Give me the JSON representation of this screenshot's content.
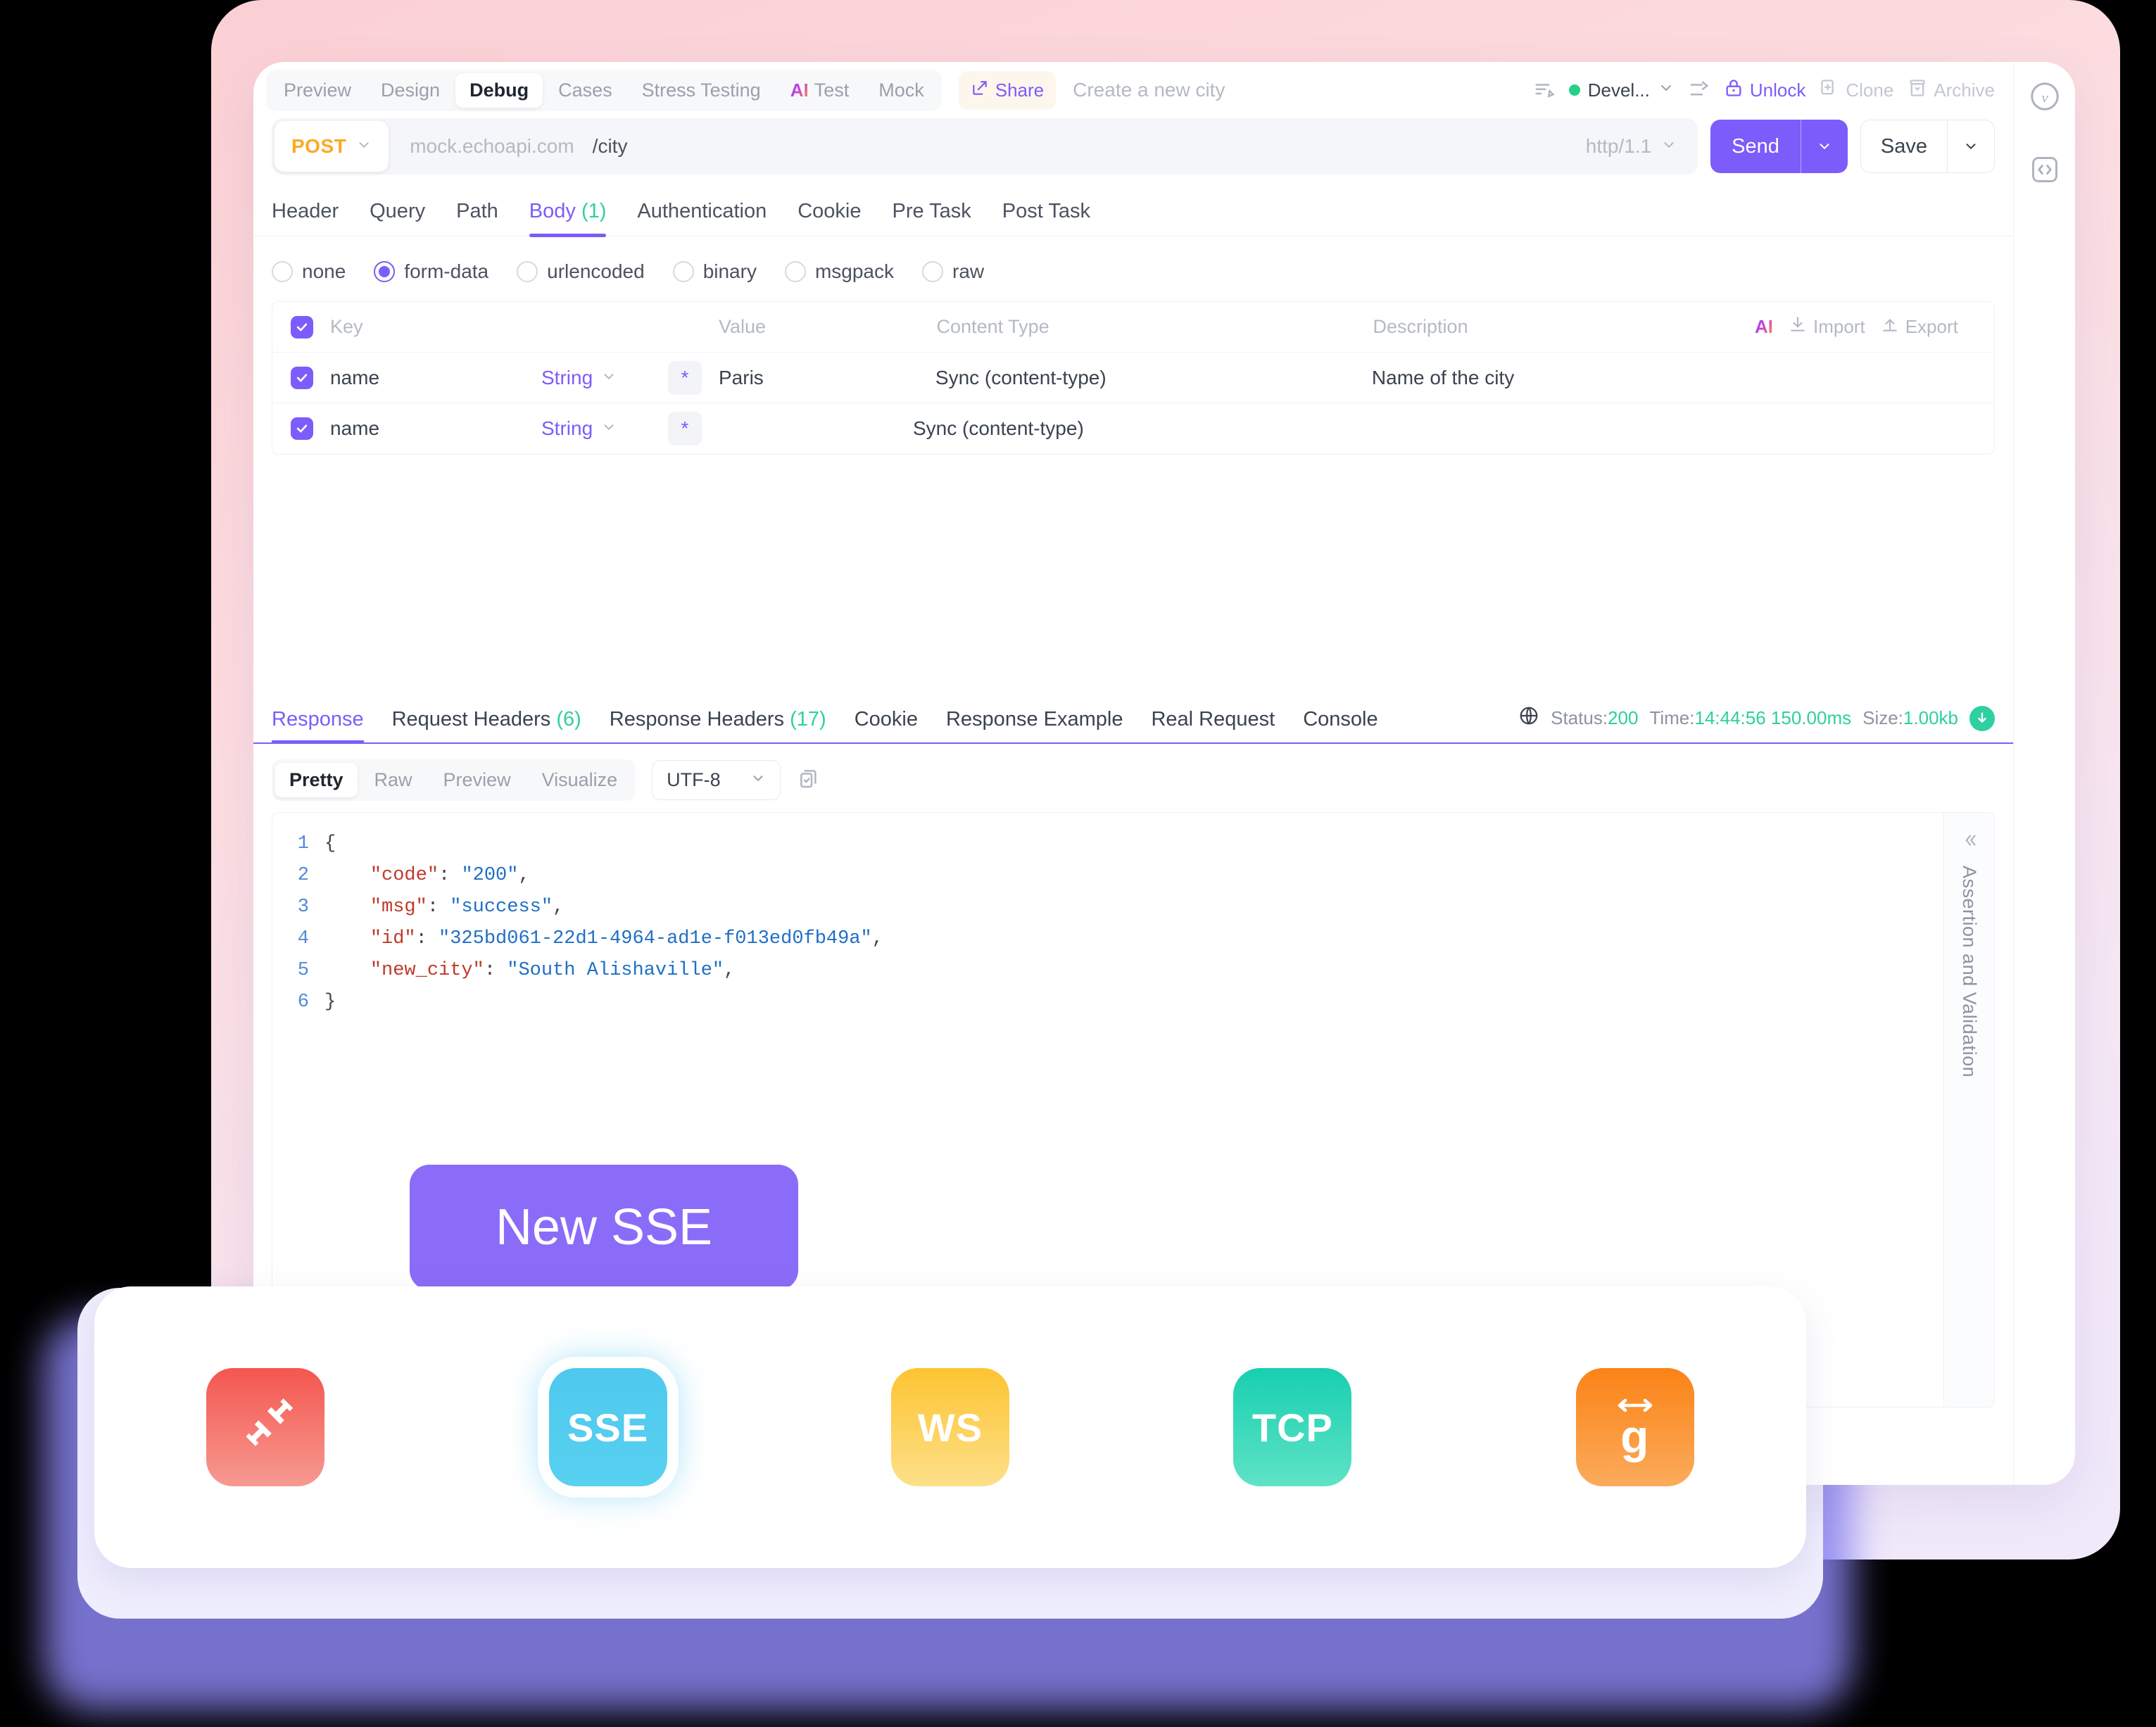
{
  "mode_tabs": [
    {
      "label": "Preview",
      "active": false,
      "ai": false
    },
    {
      "label": "Design",
      "active": false,
      "ai": false
    },
    {
      "label": "Debug",
      "active": true,
      "ai": false
    },
    {
      "label": "Cases",
      "active": false,
      "ai": false
    },
    {
      "label": "Stress Testing",
      "active": false,
      "ai": false
    },
    {
      "label": "Test",
      "active": false,
      "ai": true,
      "ai_mark": "AI"
    },
    {
      "label": "Mock",
      "active": false,
      "ai": false
    }
  ],
  "topbar": {
    "share_label": "Share",
    "request_title": "Create a new city",
    "environment": "Devel...",
    "unlock_label": "Unlock",
    "clone_label": "Clone",
    "archive_label": "Archive",
    "avatar_letter": "V"
  },
  "url_bar": {
    "method": "POST",
    "host": "mock.echoapi.com",
    "path": "/city",
    "http_version": "http/1.1",
    "send_label": "Send",
    "save_label": "Save"
  },
  "request_tabs": [
    {
      "label": "Header",
      "count": "",
      "active": false
    },
    {
      "label": "Query",
      "count": "",
      "active": false
    },
    {
      "label": "Path",
      "count": "",
      "active": false
    },
    {
      "label": "Body",
      "count": "(1)",
      "active": true
    },
    {
      "label": "Authentication",
      "count": "",
      "active": false
    },
    {
      "label": "Cookie",
      "count": "",
      "active": false
    },
    {
      "label": "Pre Task",
      "count": "",
      "active": false
    },
    {
      "label": "Post Task",
      "count": "",
      "active": false
    }
  ],
  "body_types": [
    {
      "label": "none",
      "selected": false
    },
    {
      "label": "form-data",
      "selected": true
    },
    {
      "label": "urlencoded",
      "selected": false
    },
    {
      "label": "binary",
      "selected": false
    },
    {
      "label": "msgpack",
      "selected": false
    },
    {
      "label": "raw",
      "selected": false
    }
  ],
  "params_table": {
    "headers": {
      "key": "Key",
      "value": "Value",
      "content_type": "Content Type",
      "description": "Description"
    },
    "tools": {
      "ai": "AI",
      "import": "Import",
      "export": "Export"
    },
    "rows": [
      {
        "checked": true,
        "key": "name",
        "type": "String",
        "required": "*",
        "value": "Paris",
        "content_type": "Sync (content-type)",
        "description": "Name of the city"
      },
      {
        "checked": true,
        "key": "name",
        "type": "String",
        "required": "*",
        "value": "",
        "content_type": "Sync (content-type)",
        "description": ""
      }
    ]
  },
  "response_tabs": [
    {
      "label": "Response",
      "count": "",
      "active": true
    },
    {
      "label": "Request Headers",
      "count": "(6)",
      "active": false
    },
    {
      "label": "Response Headers",
      "count": "(17)",
      "active": false
    },
    {
      "label": "Cookie",
      "count": "",
      "active": false
    },
    {
      "label": "Response Example",
      "count": "",
      "active": false
    },
    {
      "label": "Real Request",
      "count": "",
      "active": false
    },
    {
      "label": "Console",
      "count": "",
      "active": false
    }
  ],
  "response_meta": {
    "status_label": "Status:",
    "status_value": "200",
    "time_label": "Time:",
    "time_value": "14:44:56 150.00ms",
    "size_label": "Size:",
    "size_value": "1.00kb"
  },
  "format_bar": {
    "segments": [
      {
        "label": "Pretty",
        "active": true
      },
      {
        "label": "Raw",
        "active": false
      },
      {
        "label": "Preview",
        "active": false
      },
      {
        "label": "Visualize",
        "active": false
      }
    ],
    "encoding": "UTF-8"
  },
  "response_body": {
    "lines": [
      {
        "n": "1",
        "parts": [
          {
            "t": "{",
            "c": "p"
          }
        ]
      },
      {
        "n": "2",
        "parts": [
          {
            "t": "    ",
            "c": "p"
          },
          {
            "t": "\"code\"",
            "c": "k"
          },
          {
            "t": ": ",
            "c": "p"
          },
          {
            "t": "\"200\"",
            "c": "s"
          },
          {
            "t": ",",
            "c": "p"
          }
        ]
      },
      {
        "n": "3",
        "parts": [
          {
            "t": "    ",
            "c": "p"
          },
          {
            "t": "\"msg\"",
            "c": "k"
          },
          {
            "t": ": ",
            "c": "p"
          },
          {
            "t": "\"success\"",
            "c": "s"
          },
          {
            "t": ",",
            "c": "p"
          }
        ]
      },
      {
        "n": "4",
        "parts": [
          {
            "t": "    ",
            "c": "p"
          },
          {
            "t": "\"id\"",
            "c": "k"
          },
          {
            "t": ": ",
            "c": "p"
          },
          {
            "t": "\"325bd061-22d1-4964-ad1e-f013ed0fb49a\"",
            "c": "s"
          },
          {
            "t": ",",
            "c": "p"
          }
        ]
      },
      {
        "n": "5",
        "parts": [
          {
            "t": "    ",
            "c": "p"
          },
          {
            "t": "\"new_city\"",
            "c": "k"
          },
          {
            "t": ": ",
            "c": "p"
          },
          {
            "t": "\"South Alishaville\"",
            "c": "s"
          },
          {
            "t": ",",
            "c": "p"
          }
        ]
      },
      {
        "n": "6",
        "parts": [
          {
            "t": "}",
            "c": "p"
          }
        ]
      }
    ]
  },
  "assertion_panel": {
    "label": "Assertion and Validation"
  },
  "tooltip": {
    "text": "New SSE"
  },
  "protocols": [
    {
      "name": "socketio",
      "label": "",
      "icon": "plug-icon",
      "color_from": "#f4564f",
      "color_to": "#f79a91",
      "selected": false
    },
    {
      "name": "sse",
      "label": "SSE",
      "icon": "sse-text",
      "color_from": "#4ec9ee",
      "color_to": "#58d0f0",
      "selected": true
    },
    {
      "name": "websocket",
      "label": "WS",
      "icon": "ws-text",
      "color_from": "#fdc431",
      "color_to": "#fde08a",
      "selected": false
    },
    {
      "name": "tcp",
      "label": "TCP",
      "icon": "tcp-text",
      "color_from": "#18cfb0",
      "color_to": "#5fe3c6",
      "selected": false
    },
    {
      "name": "grpc",
      "label": "g",
      "icon": "grpc-icon",
      "color_from": "#fb8317",
      "color_to": "#fbab5c",
      "selected": false
    }
  ],
  "colors": {
    "accent": "#7c5cfa",
    "method": "#ffa822",
    "success": "#2ecfa0",
    "bezel_pink": "#fbd0d4",
    "glow_purple": "#8b85f0"
  }
}
